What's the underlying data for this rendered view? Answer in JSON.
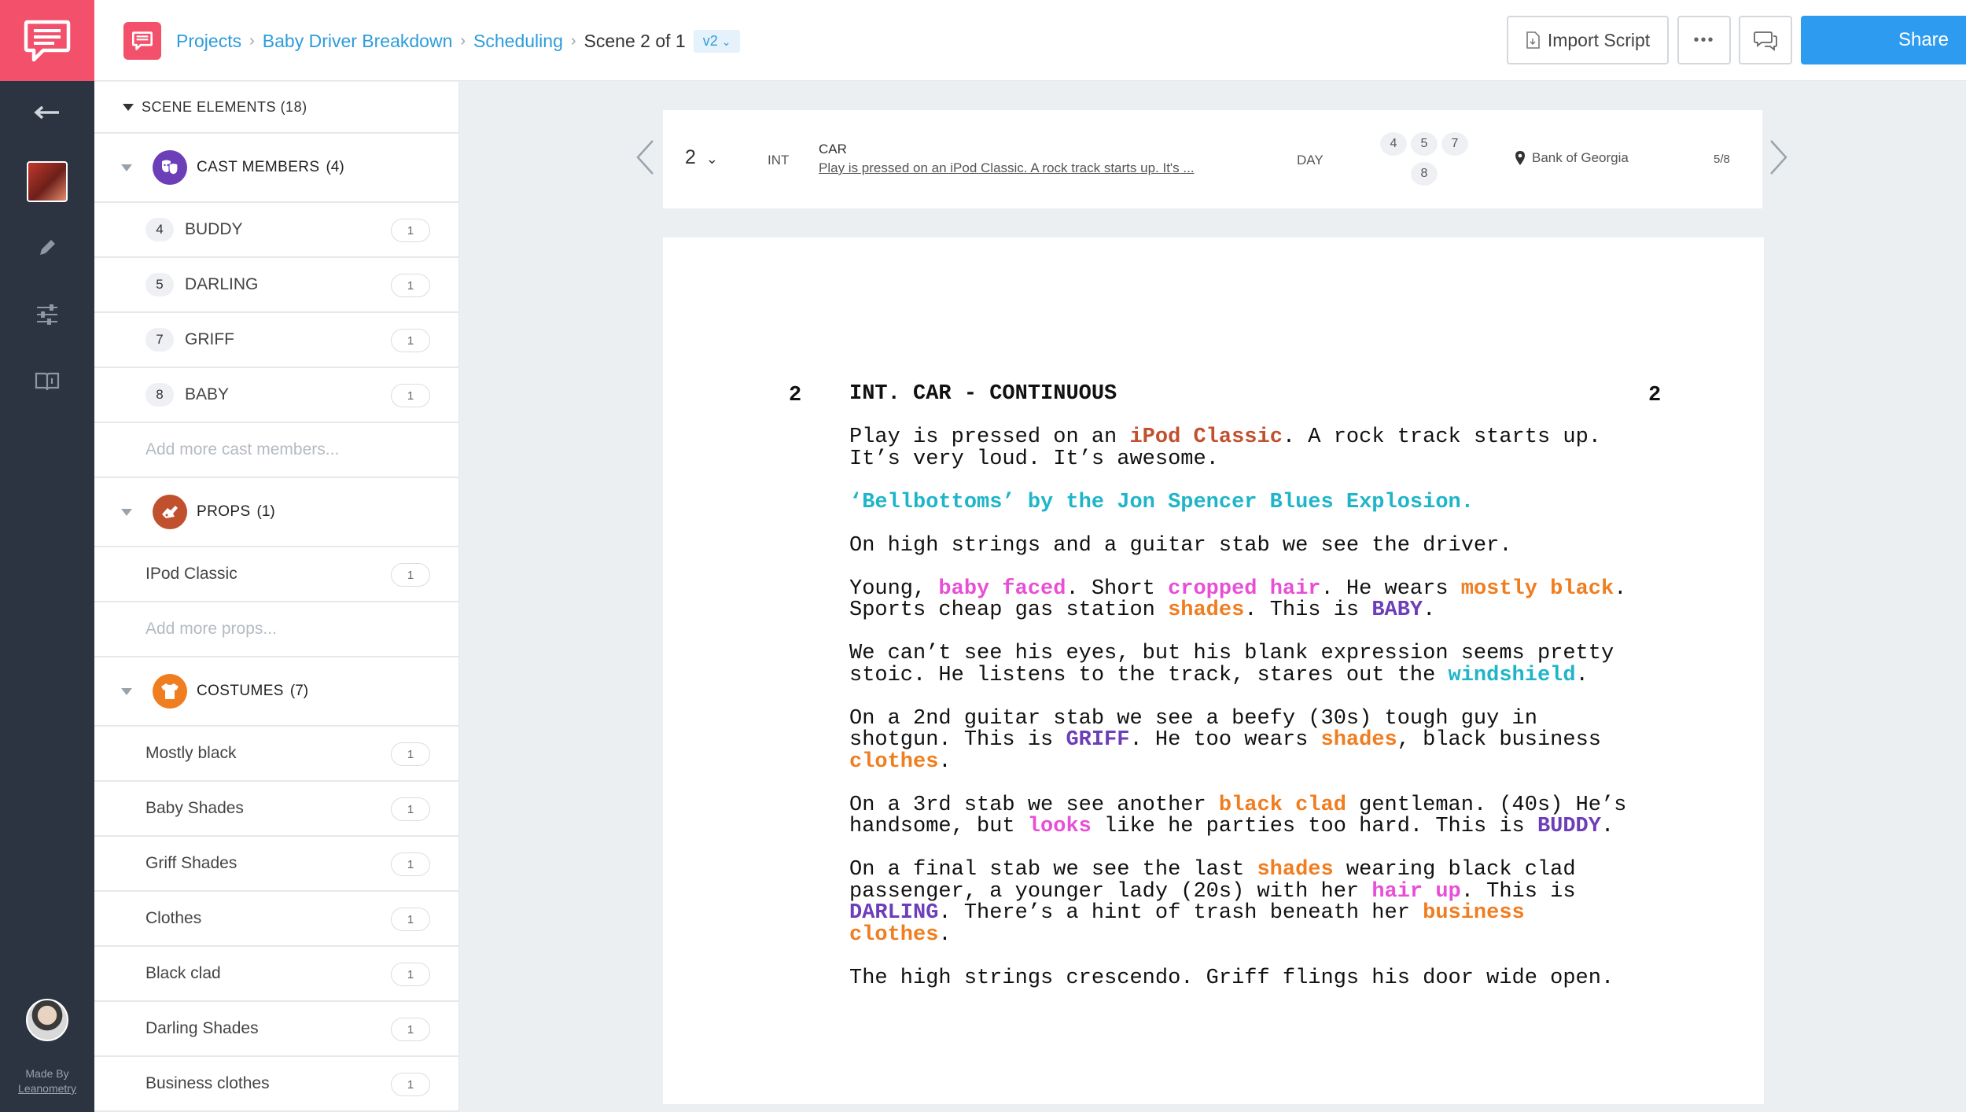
{
  "rail": {
    "made_by": "Made By",
    "made_by_link": "Leanometry"
  },
  "topbar": {
    "breadcrumb": [
      "Projects",
      "Baby Driver Breakdown",
      "Scheduling"
    ],
    "current": "Scene 2 of 1",
    "version": "v2",
    "import_label": "Import Script",
    "more_label": "•••",
    "share_label": "Share"
  },
  "sidebar": {
    "header_label": "SCENE ELEMENTS",
    "header_count": "(18)",
    "cast": {
      "label": "CAST MEMBERS",
      "count": "(4)",
      "items": [
        {
          "num": "4",
          "name": "BUDDY",
          "badge": "1"
        },
        {
          "num": "5",
          "name": "DARLING",
          "badge": "1"
        },
        {
          "num": "7",
          "name": "GRIFF",
          "badge": "1"
        },
        {
          "num": "8",
          "name": "BABY",
          "badge": "1"
        }
      ],
      "add": "Add more cast members..."
    },
    "props": {
      "label": "PROPS",
      "count": "(1)",
      "items": [
        {
          "name": "IPod Classic",
          "badge": "1"
        }
      ],
      "add": "Add more props..."
    },
    "costumes": {
      "label": "COSTUMES",
      "count": "(7)",
      "items": [
        {
          "name": "Mostly black",
          "badge": "1"
        },
        {
          "name": "Baby Shades",
          "badge": "1"
        },
        {
          "name": "Griff Shades",
          "badge": "1"
        },
        {
          "name": "Clothes",
          "badge": "1"
        },
        {
          "name": "Black clad",
          "badge": "1"
        },
        {
          "name": "Darling Shades",
          "badge": "1"
        },
        {
          "name": "Business clothes",
          "badge": "1"
        }
      ]
    }
  },
  "scene_bar": {
    "number": "2",
    "int_ext": "INT",
    "set": "CAR",
    "synopsis": "Play is pressed on an iPod Classic. A rock track starts up. It's ...",
    "time": "DAY",
    "cast_ids": [
      "4",
      "5",
      "7",
      "8"
    ],
    "location": "Bank of Georgia",
    "length": "5/8"
  },
  "script": {
    "scene_number": "2",
    "slug": "INT. CAR - CONTINUOUS",
    "p1a": "Play is pressed on an ",
    "p1_prop": "iPod Classic",
    "p1b": ". A rock track starts up.",
    "p1c": "It’s very loud. It’s awesome.",
    "music": "‘Bellbottoms’ by the Jon Spencer Blues Explosion.",
    "p3": "On high strings and a guitar stab we see the driver.",
    "p4a": "Young, ",
    "p4_h1": "baby faced",
    "p4b": ". Short ",
    "p4_h2": "cropped hair",
    "p4c": ". He wears ",
    "p4_c1": "mostly black",
    "p4d": ".",
    "p4e": "Sports cheap gas station ",
    "p4_c2": "shades",
    "p4f": ". This is ",
    "p4_cast": "BABY",
    "p4g": ".",
    "p5a": "We can’t see his eyes, but his blank expression seems pretty",
    "p5b": "stoic. He listens to the track, stares out the ",
    "p5_v": "windshield",
    "p5c": ".",
    "p6a": "On a 2nd guitar stab we see a beefy (30s) tough guy in",
    "p6b": "shotgun. This is ",
    "p6_cast": "GRIFF",
    "p6c": ". He too wears ",
    "p6_c1": "shades",
    "p6d": ", black business",
    "p6_c2": "clothes",
    "p6e": ".",
    "p7a": "On a 3rd stab we see another ",
    "p7_c1": "black clad",
    "p7b": " gentleman. (40s) He’s",
    "p7c": "handsome, but ",
    "p7_h": "looks",
    "p7d": " like he parties too hard. This is ",
    "p7_cast": "BUDDY",
    "p7e": ".",
    "p8a": "On a final stab we see the last ",
    "p8_c1": "shades",
    "p8b": " wearing black clad",
    "p8c": "passenger, a younger lady (20s) with her ",
    "p8_h": "hair up",
    "p8d": ". This is",
    "p8_cast": "DARLING",
    "p8e": ". There’s a hint of trash beneath her ",
    "p8_c2": "business",
    "p8_c3": "clothes",
    "p8f": ".",
    "p9": "The high strings crescendo. Griff flings his door wide open."
  }
}
